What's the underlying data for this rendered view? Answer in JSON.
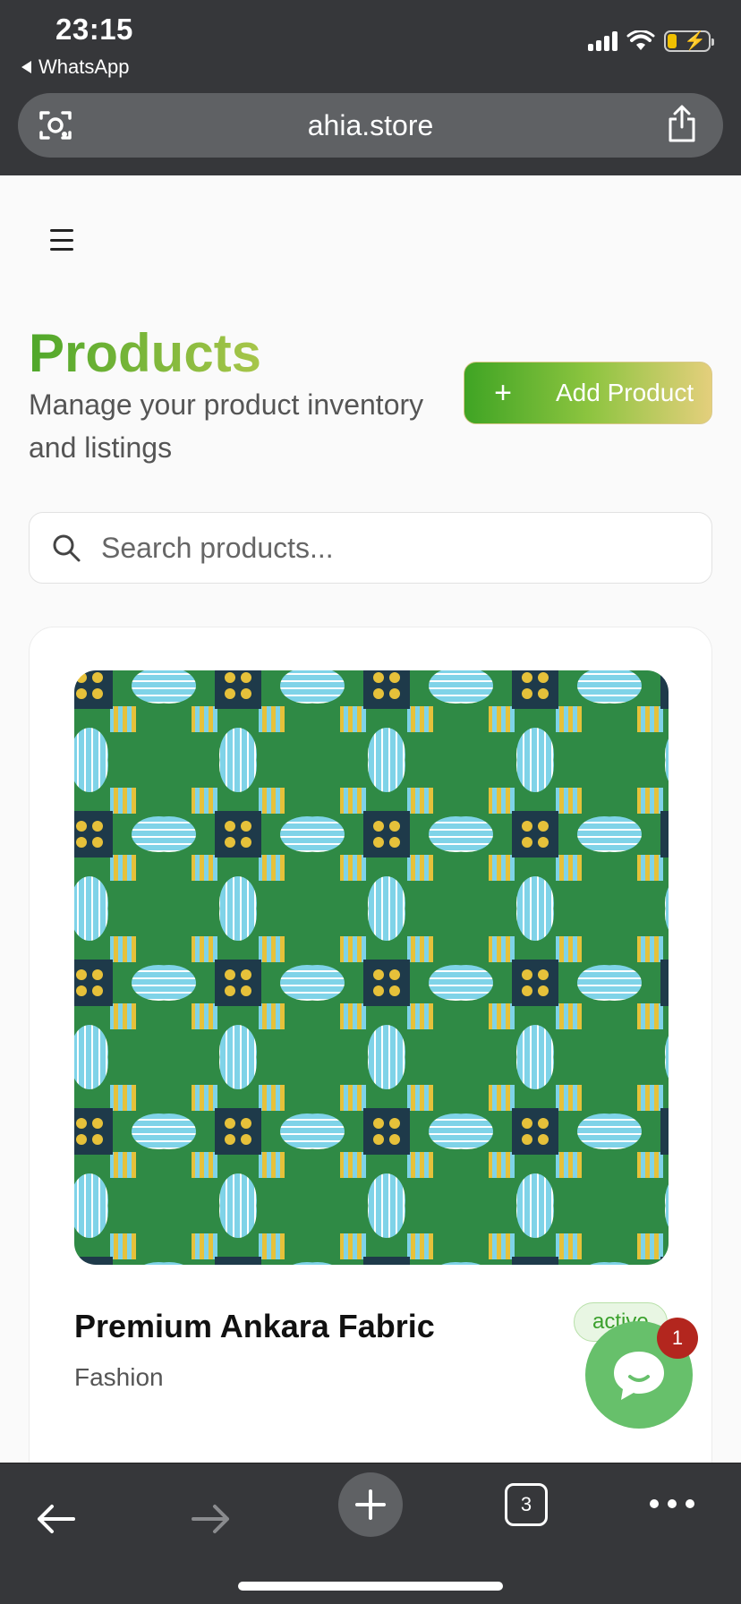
{
  "status_bar": {
    "time": "23:15",
    "back_app": "WhatsApp"
  },
  "browser": {
    "url": "ahia.store",
    "tab_count": "3"
  },
  "header": {
    "title": "Products",
    "subtitle": "Manage your product inventory and listings",
    "add_button_label": "Add Product",
    "add_button_icon": "+"
  },
  "search": {
    "placeholder": "Search products...",
    "value": ""
  },
  "products": [
    {
      "name": "Premium Ankara Fabric",
      "category": "Fashion",
      "status": "active",
      "image_icon": "ankara-pattern-image"
    }
  ],
  "chat": {
    "unread_count": "1"
  },
  "colors": {
    "brand_green": "#4fa72a",
    "brand_gold": "#e4cf7c",
    "chat_green": "#67c06b",
    "badge_red": "#b3261e",
    "fabric_green": "#2f8a45",
    "fabric_blue": "#7fd3e8",
    "fabric_yellow": "#e6c13a",
    "fabric_navy": "#1e3a4a"
  }
}
